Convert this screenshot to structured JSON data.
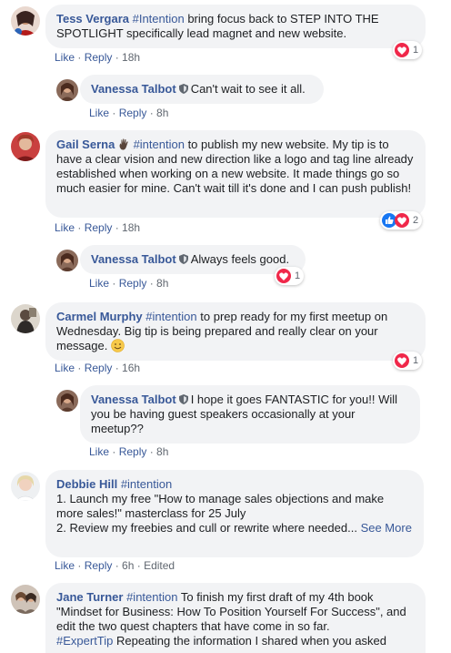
{
  "comments": [
    {
      "name": "Tess Vergara",
      "hashtag": "#Intention",
      "text": " bring focus back to STEP INTO THE SPOTLIGHT specifically lead magnet and new website.",
      "like": "Like",
      "reply": "Reply",
      "time": "18h",
      "reaction_count": "1"
    },
    {
      "name": "Vanessa Talbot",
      "text": "Can't wait to see it all.",
      "like": "Like",
      "reply": "Reply",
      "time": "8h"
    },
    {
      "name": "Gail Serna",
      "hashtag": "#intention",
      "text": " to publish my new website. My tip is to have a clear vision and new direction like a logo and tag line already established when working on a new website. It made things go so much easier for mine. Can't wait till it's done and I can push publish!",
      "like": "Like",
      "reply": "Reply",
      "time": "18h",
      "reaction_count": "2"
    },
    {
      "name": "Vanessa Talbot",
      "text": "Always feels good.",
      "like": "Like",
      "reply": "Reply",
      "time": "8h",
      "reaction_count": "1"
    },
    {
      "name": "Carmel Murphy",
      "hashtag": "#intention",
      "text": " to prep ready for my first meetup on Wednesday. Big tip is being prepared and really clear on your message.",
      "like": "Like",
      "reply": "Reply",
      "time": "16h",
      "reaction_count": "1"
    },
    {
      "name": "Vanessa Talbot",
      "text": "I hope it goes FANTASTIC for you!! Will you be having guest speakers occasionally at your meetup??",
      "like": "Like",
      "reply": "Reply",
      "time": "8h"
    },
    {
      "name": "Debbie Hill",
      "hashtag": "#intention",
      "line1": "1. Launch my free \"How to manage sales objections and make more sales!\" masterclass for 25 July",
      "line2": "2. Review my freebies and cull or rewrite where needed...",
      "see_more": "See More",
      "like": "Like",
      "reply": "Reply",
      "time": "6h",
      "edited": "Edited"
    },
    {
      "name": "Jane Turner",
      "hashtag": "#intention",
      "text": " To finish my first draft of my 4th book \"Mindset for Business: How To Position Yourself For Success\", and edit the two quest chapters that have come in so far.",
      "hashtag2": "#ExpertTip",
      "text2": " Repeating the information I shared when you asked"
    }
  ],
  "colors": {
    "link": "#385898",
    "bubble": "#f2f3f5",
    "heart": "#f0284a",
    "like": "#1877f2"
  }
}
